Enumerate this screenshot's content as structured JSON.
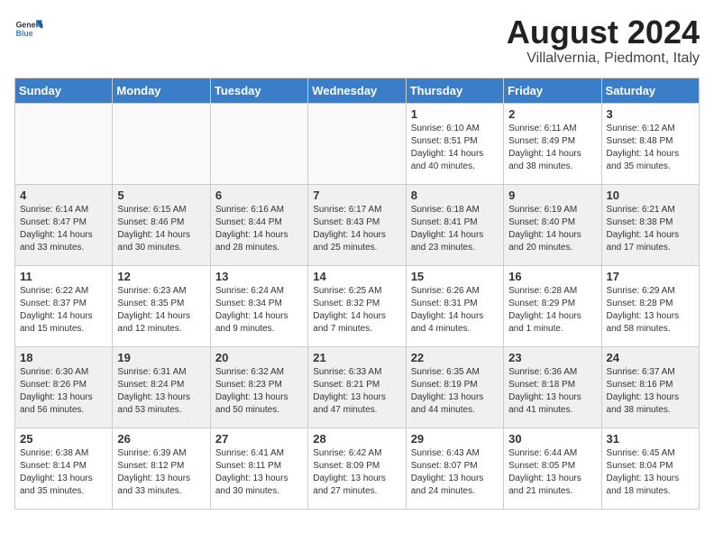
{
  "header": {
    "logo_general": "General",
    "logo_blue": "Blue",
    "month_year": "August 2024",
    "location": "Villalvernia, Piedmont, Italy"
  },
  "weekdays": [
    "Sunday",
    "Monday",
    "Tuesday",
    "Wednesday",
    "Thursday",
    "Friday",
    "Saturday"
  ],
  "weeks": [
    [
      {
        "day": "",
        "info": "",
        "empty": true
      },
      {
        "day": "",
        "info": "",
        "empty": true
      },
      {
        "day": "",
        "info": "",
        "empty": true
      },
      {
        "day": "",
        "info": "",
        "empty": true
      },
      {
        "day": "1",
        "info": "Sunrise: 6:10 AM\nSunset: 8:51 PM\nDaylight: 14 hours\nand 40 minutes.",
        "empty": false
      },
      {
        "day": "2",
        "info": "Sunrise: 6:11 AM\nSunset: 8:49 PM\nDaylight: 14 hours\nand 38 minutes.",
        "empty": false
      },
      {
        "day": "3",
        "info": "Sunrise: 6:12 AM\nSunset: 8:48 PM\nDaylight: 14 hours\nand 35 minutes.",
        "empty": false
      }
    ],
    [
      {
        "day": "4",
        "info": "Sunrise: 6:14 AM\nSunset: 8:47 PM\nDaylight: 14 hours\nand 33 minutes.",
        "empty": false
      },
      {
        "day": "5",
        "info": "Sunrise: 6:15 AM\nSunset: 8:46 PM\nDaylight: 14 hours\nand 30 minutes.",
        "empty": false
      },
      {
        "day": "6",
        "info": "Sunrise: 6:16 AM\nSunset: 8:44 PM\nDaylight: 14 hours\nand 28 minutes.",
        "empty": false
      },
      {
        "day": "7",
        "info": "Sunrise: 6:17 AM\nSunset: 8:43 PM\nDaylight: 14 hours\nand 25 minutes.",
        "empty": false
      },
      {
        "day": "8",
        "info": "Sunrise: 6:18 AM\nSunset: 8:41 PM\nDaylight: 14 hours\nand 23 minutes.",
        "empty": false
      },
      {
        "day": "9",
        "info": "Sunrise: 6:19 AM\nSunset: 8:40 PM\nDaylight: 14 hours\nand 20 minutes.",
        "empty": false
      },
      {
        "day": "10",
        "info": "Sunrise: 6:21 AM\nSunset: 8:38 PM\nDaylight: 14 hours\nand 17 minutes.",
        "empty": false
      }
    ],
    [
      {
        "day": "11",
        "info": "Sunrise: 6:22 AM\nSunset: 8:37 PM\nDaylight: 14 hours\nand 15 minutes.",
        "empty": false
      },
      {
        "day": "12",
        "info": "Sunrise: 6:23 AM\nSunset: 8:35 PM\nDaylight: 14 hours\nand 12 minutes.",
        "empty": false
      },
      {
        "day": "13",
        "info": "Sunrise: 6:24 AM\nSunset: 8:34 PM\nDaylight: 14 hours\nand 9 minutes.",
        "empty": false
      },
      {
        "day": "14",
        "info": "Sunrise: 6:25 AM\nSunset: 8:32 PM\nDaylight: 14 hours\nand 7 minutes.",
        "empty": false
      },
      {
        "day": "15",
        "info": "Sunrise: 6:26 AM\nSunset: 8:31 PM\nDaylight: 14 hours\nand 4 minutes.",
        "empty": false
      },
      {
        "day": "16",
        "info": "Sunrise: 6:28 AM\nSunset: 8:29 PM\nDaylight: 14 hours\nand 1 minute.",
        "empty": false
      },
      {
        "day": "17",
        "info": "Sunrise: 6:29 AM\nSunset: 8:28 PM\nDaylight: 13 hours\nand 58 minutes.",
        "empty": false
      }
    ],
    [
      {
        "day": "18",
        "info": "Sunrise: 6:30 AM\nSunset: 8:26 PM\nDaylight: 13 hours\nand 56 minutes.",
        "empty": false
      },
      {
        "day": "19",
        "info": "Sunrise: 6:31 AM\nSunset: 8:24 PM\nDaylight: 13 hours\nand 53 minutes.",
        "empty": false
      },
      {
        "day": "20",
        "info": "Sunrise: 6:32 AM\nSunset: 8:23 PM\nDaylight: 13 hours\nand 50 minutes.",
        "empty": false
      },
      {
        "day": "21",
        "info": "Sunrise: 6:33 AM\nSunset: 8:21 PM\nDaylight: 13 hours\nand 47 minutes.",
        "empty": false
      },
      {
        "day": "22",
        "info": "Sunrise: 6:35 AM\nSunset: 8:19 PM\nDaylight: 13 hours\nand 44 minutes.",
        "empty": false
      },
      {
        "day": "23",
        "info": "Sunrise: 6:36 AM\nSunset: 8:18 PM\nDaylight: 13 hours\nand 41 minutes.",
        "empty": false
      },
      {
        "day": "24",
        "info": "Sunrise: 6:37 AM\nSunset: 8:16 PM\nDaylight: 13 hours\nand 38 minutes.",
        "empty": false
      }
    ],
    [
      {
        "day": "25",
        "info": "Sunrise: 6:38 AM\nSunset: 8:14 PM\nDaylight: 13 hours\nand 35 minutes.",
        "empty": false
      },
      {
        "day": "26",
        "info": "Sunrise: 6:39 AM\nSunset: 8:12 PM\nDaylight: 13 hours\nand 33 minutes.",
        "empty": false
      },
      {
        "day": "27",
        "info": "Sunrise: 6:41 AM\nSunset: 8:11 PM\nDaylight: 13 hours\nand 30 minutes.",
        "empty": false
      },
      {
        "day": "28",
        "info": "Sunrise: 6:42 AM\nSunset: 8:09 PM\nDaylight: 13 hours\nand 27 minutes.",
        "empty": false
      },
      {
        "day": "29",
        "info": "Sunrise: 6:43 AM\nSunset: 8:07 PM\nDaylight: 13 hours\nand 24 minutes.",
        "empty": false
      },
      {
        "day": "30",
        "info": "Sunrise: 6:44 AM\nSunset: 8:05 PM\nDaylight: 13 hours\nand 21 minutes.",
        "empty": false
      },
      {
        "day": "31",
        "info": "Sunrise: 6:45 AM\nSunset: 8:04 PM\nDaylight: 13 hours\nand 18 minutes.",
        "empty": false
      }
    ]
  ]
}
